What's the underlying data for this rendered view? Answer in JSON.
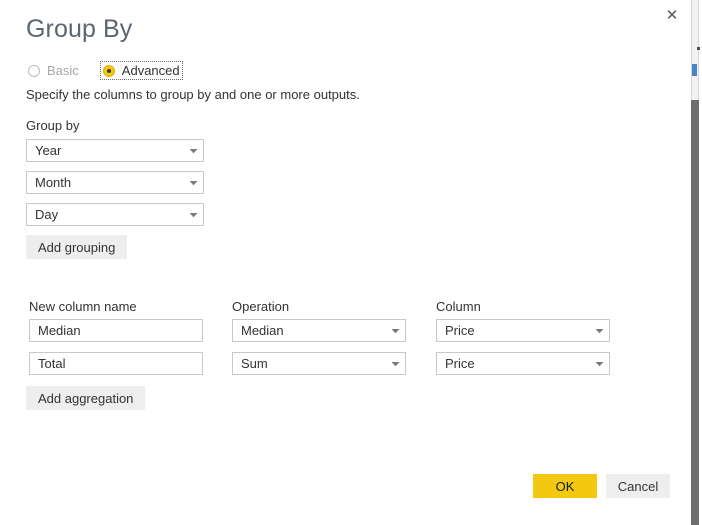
{
  "dialog": {
    "title": "Group By",
    "description": "Specify the columns to group by and one or more outputs.",
    "close_icon": "close-icon",
    "close_glyph": "✕"
  },
  "mode": {
    "options": [
      {
        "label": "Basic",
        "selected": false,
        "focused": false
      },
      {
        "label": "Advanced",
        "selected": true,
        "focused": true
      }
    ]
  },
  "group_by": {
    "label": "Group by",
    "rows": [
      {
        "value": "Year"
      },
      {
        "value": "Month"
      },
      {
        "value": "Day"
      }
    ],
    "add_button_label": "Add grouping"
  },
  "aggregations": {
    "headers": {
      "new_column_name": "New column name",
      "operation": "Operation",
      "column": "Column"
    },
    "rows": [
      {
        "name": "Median",
        "operation": "Median",
        "column": "Price"
      },
      {
        "name": "Total",
        "operation": "Sum",
        "column": "Price"
      }
    ],
    "add_button_label": "Add aggregation"
  },
  "footer": {
    "ok_label": "OK",
    "cancel_label": "Cancel"
  },
  "colors": {
    "accent_yellow": "#F2C811",
    "button_gray": "#EEEEEE",
    "border_gray": "#C8C8C8",
    "title_gray": "#5C6670",
    "text": "#333333",
    "disabled_text": "#A6A6A6"
  }
}
